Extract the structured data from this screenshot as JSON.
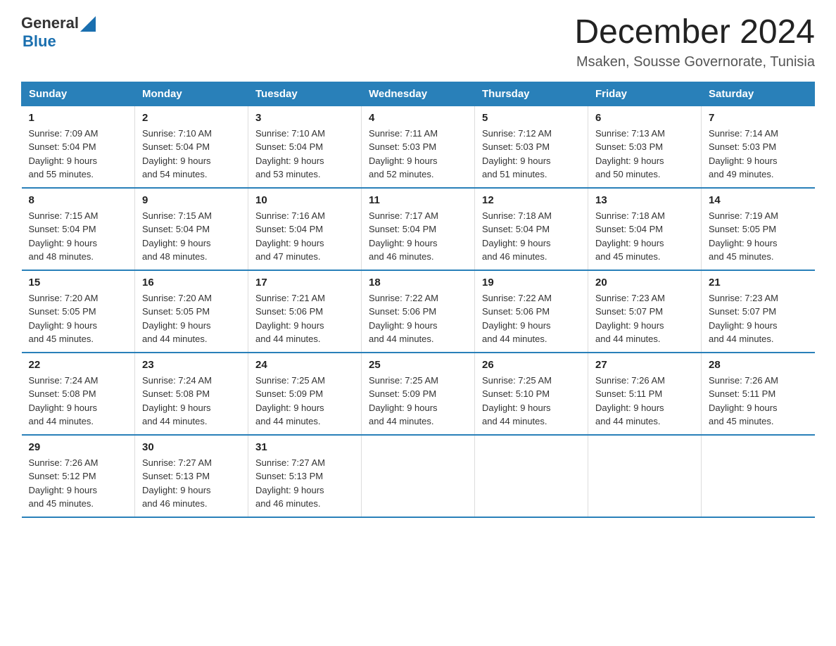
{
  "header": {
    "month_title": "December 2024",
    "location": "Msaken, Sousse Governorate, Tunisia",
    "logo_general": "General",
    "logo_blue": "Blue"
  },
  "weekdays": [
    "Sunday",
    "Monday",
    "Tuesday",
    "Wednesday",
    "Thursday",
    "Friday",
    "Saturday"
  ],
  "weeks": [
    [
      {
        "day": "1",
        "sunrise": "7:09 AM",
        "sunset": "5:04 PM",
        "daylight": "9 hours and 55 minutes."
      },
      {
        "day": "2",
        "sunrise": "7:10 AM",
        "sunset": "5:04 PM",
        "daylight": "9 hours and 54 minutes."
      },
      {
        "day": "3",
        "sunrise": "7:10 AM",
        "sunset": "5:04 PM",
        "daylight": "9 hours and 53 minutes."
      },
      {
        "day": "4",
        "sunrise": "7:11 AM",
        "sunset": "5:03 PM",
        "daylight": "9 hours and 52 minutes."
      },
      {
        "day": "5",
        "sunrise": "7:12 AM",
        "sunset": "5:03 PM",
        "daylight": "9 hours and 51 minutes."
      },
      {
        "day": "6",
        "sunrise": "7:13 AM",
        "sunset": "5:03 PM",
        "daylight": "9 hours and 50 minutes."
      },
      {
        "day": "7",
        "sunrise": "7:14 AM",
        "sunset": "5:03 PM",
        "daylight": "9 hours and 49 minutes."
      }
    ],
    [
      {
        "day": "8",
        "sunrise": "7:15 AM",
        "sunset": "5:04 PM",
        "daylight": "9 hours and 48 minutes."
      },
      {
        "day": "9",
        "sunrise": "7:15 AM",
        "sunset": "5:04 PM",
        "daylight": "9 hours and 48 minutes."
      },
      {
        "day": "10",
        "sunrise": "7:16 AM",
        "sunset": "5:04 PM",
        "daylight": "9 hours and 47 minutes."
      },
      {
        "day": "11",
        "sunrise": "7:17 AM",
        "sunset": "5:04 PM",
        "daylight": "9 hours and 46 minutes."
      },
      {
        "day": "12",
        "sunrise": "7:18 AM",
        "sunset": "5:04 PM",
        "daylight": "9 hours and 46 minutes."
      },
      {
        "day": "13",
        "sunrise": "7:18 AM",
        "sunset": "5:04 PM",
        "daylight": "9 hours and 45 minutes."
      },
      {
        "day": "14",
        "sunrise": "7:19 AM",
        "sunset": "5:05 PM",
        "daylight": "9 hours and 45 minutes."
      }
    ],
    [
      {
        "day": "15",
        "sunrise": "7:20 AM",
        "sunset": "5:05 PM",
        "daylight": "9 hours and 45 minutes."
      },
      {
        "day": "16",
        "sunrise": "7:20 AM",
        "sunset": "5:05 PM",
        "daylight": "9 hours and 44 minutes."
      },
      {
        "day": "17",
        "sunrise": "7:21 AM",
        "sunset": "5:06 PM",
        "daylight": "9 hours and 44 minutes."
      },
      {
        "day": "18",
        "sunrise": "7:22 AM",
        "sunset": "5:06 PM",
        "daylight": "9 hours and 44 minutes."
      },
      {
        "day": "19",
        "sunrise": "7:22 AM",
        "sunset": "5:06 PM",
        "daylight": "9 hours and 44 minutes."
      },
      {
        "day": "20",
        "sunrise": "7:23 AM",
        "sunset": "5:07 PM",
        "daylight": "9 hours and 44 minutes."
      },
      {
        "day": "21",
        "sunrise": "7:23 AM",
        "sunset": "5:07 PM",
        "daylight": "9 hours and 44 minutes."
      }
    ],
    [
      {
        "day": "22",
        "sunrise": "7:24 AM",
        "sunset": "5:08 PM",
        "daylight": "9 hours and 44 minutes."
      },
      {
        "day": "23",
        "sunrise": "7:24 AM",
        "sunset": "5:08 PM",
        "daylight": "9 hours and 44 minutes."
      },
      {
        "day": "24",
        "sunrise": "7:25 AM",
        "sunset": "5:09 PM",
        "daylight": "9 hours and 44 minutes."
      },
      {
        "day": "25",
        "sunrise": "7:25 AM",
        "sunset": "5:09 PM",
        "daylight": "9 hours and 44 minutes."
      },
      {
        "day": "26",
        "sunrise": "7:25 AM",
        "sunset": "5:10 PM",
        "daylight": "9 hours and 44 minutes."
      },
      {
        "day": "27",
        "sunrise": "7:26 AM",
        "sunset": "5:11 PM",
        "daylight": "9 hours and 44 minutes."
      },
      {
        "day": "28",
        "sunrise": "7:26 AM",
        "sunset": "5:11 PM",
        "daylight": "9 hours and 45 minutes."
      }
    ],
    [
      {
        "day": "29",
        "sunrise": "7:26 AM",
        "sunset": "5:12 PM",
        "daylight": "9 hours and 45 minutes."
      },
      {
        "day": "30",
        "sunrise": "7:27 AM",
        "sunset": "5:13 PM",
        "daylight": "9 hours and 46 minutes."
      },
      {
        "day": "31",
        "sunrise": "7:27 AM",
        "sunset": "5:13 PM",
        "daylight": "9 hours and 46 minutes."
      },
      null,
      null,
      null,
      null
    ]
  ],
  "labels": {
    "sunrise": "Sunrise:",
    "sunset": "Sunset:",
    "daylight": "Daylight:"
  }
}
